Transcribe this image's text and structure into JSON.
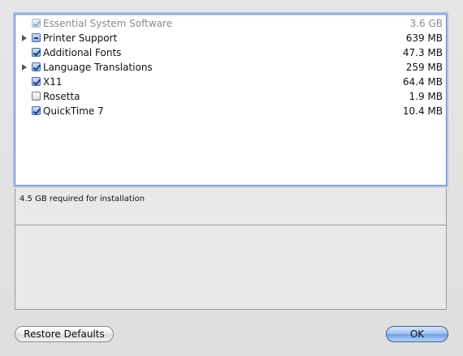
{
  "packages": [
    {
      "name": "Essential System Software",
      "size": "3.6 GB",
      "state": "checked",
      "disabled": true,
      "expandable": false
    },
    {
      "name": "Printer Support",
      "size": "639 MB",
      "state": "mixed",
      "disabled": false,
      "expandable": true
    },
    {
      "name": "Additional Fonts",
      "size": "47.3 MB",
      "state": "checked",
      "disabled": false,
      "expandable": false
    },
    {
      "name": "Language Translations",
      "size": "259 MB",
      "state": "checked",
      "disabled": false,
      "expandable": true
    },
    {
      "name": "X11",
      "size": "64.4 MB",
      "state": "checked",
      "disabled": false,
      "expandable": false
    },
    {
      "name": "Rosetta",
      "size": "1.9 MB",
      "state": "unchecked",
      "disabled": false,
      "expandable": false
    },
    {
      "name": "QuickTime 7",
      "size": "10.4 MB",
      "state": "checked",
      "disabled": false,
      "expandable": false
    }
  ],
  "summary": {
    "required_text": "4.5 GB required for installation"
  },
  "buttons": {
    "restore_label": "Restore Defaults",
    "ok_label": "OK"
  },
  "colors": {
    "focus_ring": "#a9c4ec",
    "checkbox_checked": "#8db1e4",
    "ok_button": "#6e9ee4"
  },
  "icons": {
    "disclosure": "disclosure-triangle-icon",
    "checkbox": "checkbox-icon"
  }
}
